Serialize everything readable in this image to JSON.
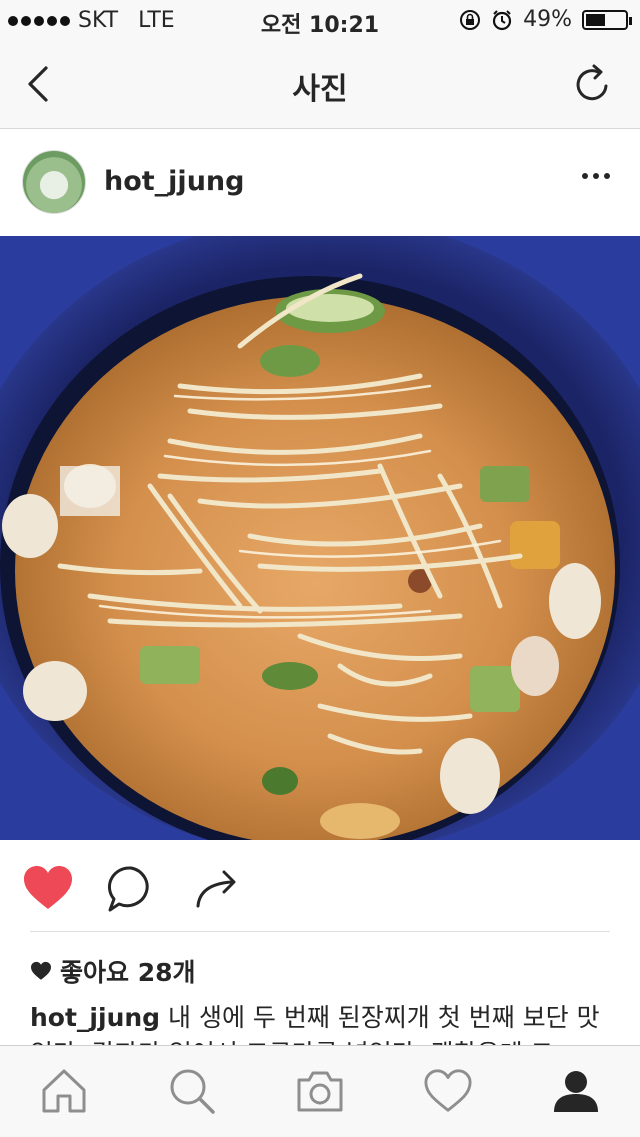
{
  "status": {
    "carrier": "SKT",
    "network": "LTE",
    "time": "오전 10:21",
    "battery": "49%",
    "battery_level": 0.49
  },
  "nav": {
    "title": "사진",
    "back_icon": "chevron-left-icon",
    "refresh_icon": "refresh-icon"
  },
  "post": {
    "username": "hot_jjung",
    "likes": "좋아요 28개",
    "caption_user": "hot_jjung",
    "caption_text": " 내 생에 두 번째 된장찌개 첫 번째 보단 맛있다. 감자가 없어서 고구마를 넣었다. 괜찮은데 그"
  },
  "colors": {
    "heart_red": "#ed4956",
    "text": "#262626",
    "bar_bg": "#f8f8f8"
  },
  "tabs": [
    {
      "icon": "home-icon"
    },
    {
      "icon": "search-icon"
    },
    {
      "icon": "camera-icon"
    },
    {
      "icon": "activity-heart-icon"
    },
    {
      "icon": "profile-icon"
    }
  ]
}
